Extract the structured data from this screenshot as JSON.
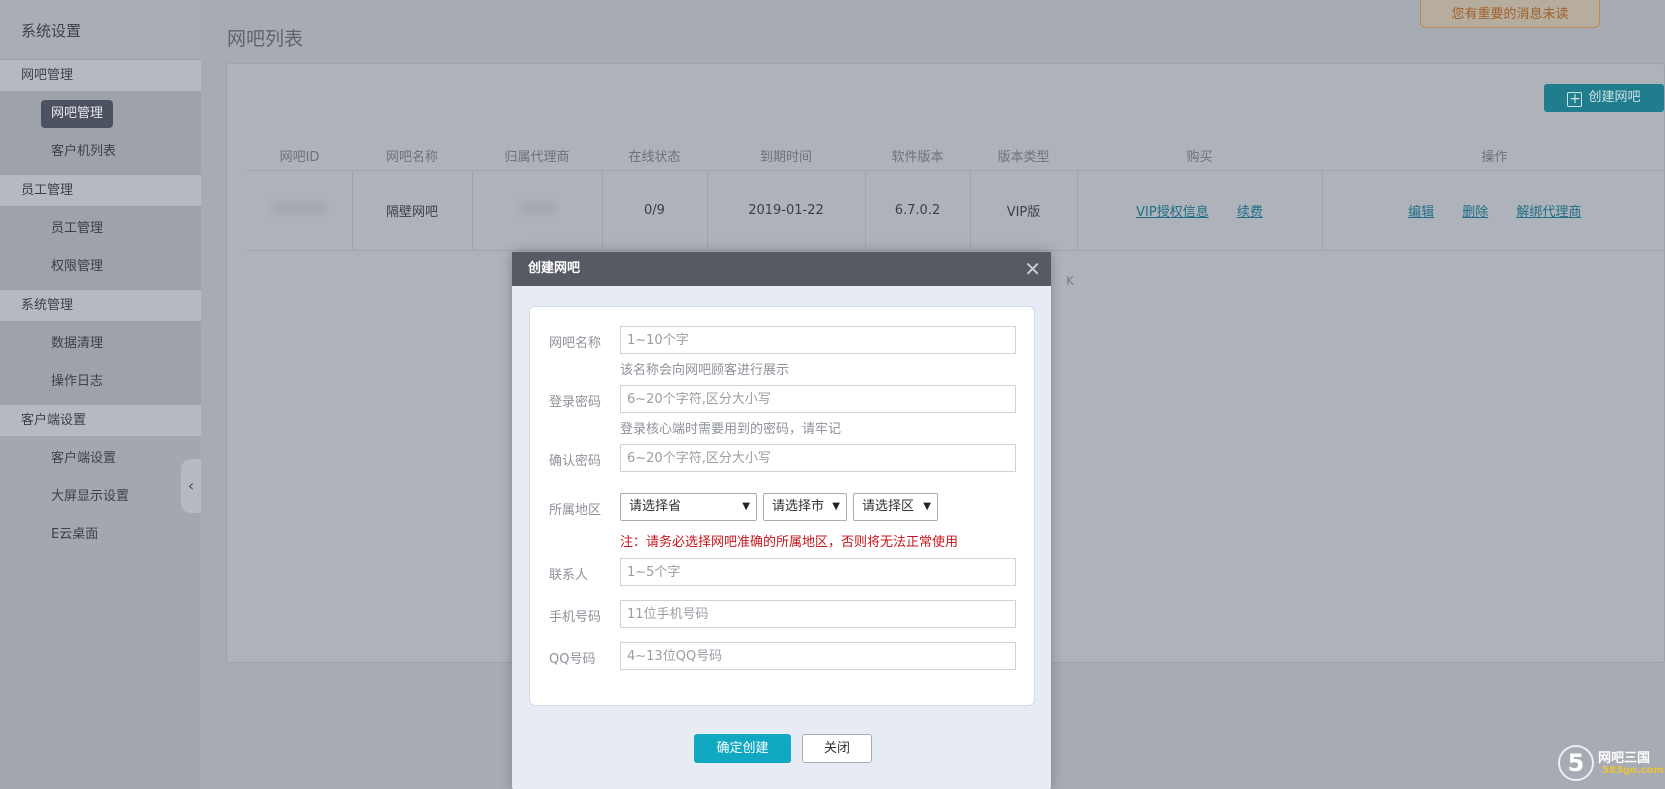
{
  "sidebar": {
    "title": "系统设置",
    "groups": [
      {
        "label": "网吧管理",
        "items": [
          {
            "label": "网吧管理",
            "active": true
          },
          {
            "label": "客户机列表"
          }
        ]
      },
      {
        "label": "员工管理",
        "items": [
          {
            "label": "员工管理"
          },
          {
            "label": "权限管理"
          }
        ]
      },
      {
        "label": "系统管理",
        "items": [
          {
            "label": "数据清理"
          },
          {
            "label": "操作日志"
          }
        ]
      },
      {
        "label": "客户端设置",
        "items": [
          {
            "label": "客户端设置"
          },
          {
            "label": "大屏显示设置"
          },
          {
            "label": "E云桌面"
          }
        ]
      }
    ],
    "collapse_icon": "‹"
  },
  "main": {
    "page_title": "网吧列表",
    "notice": "您有重要的消息未读",
    "create_button": "创建网吧",
    "table": {
      "headers": [
        "网吧ID",
        "网吧名称",
        "归属代理商",
        "在线状态",
        "到期时间",
        "软件版本",
        "版本类型",
        "购买",
        "操作"
      ],
      "row": {
        "name": "隔壁网吧",
        "online": "0/9",
        "expire": "2019-01-22",
        "version": "6.7.0.2",
        "edition": "VIP版",
        "buy_links": [
          "VIP授权信息",
          "续费"
        ],
        "op_links": [
          "编辑",
          "删除",
          "解绑代理商"
        ]
      }
    },
    "pager_fragment": "K"
  },
  "modal": {
    "title": "创建网吧",
    "close": "✕",
    "fields": {
      "name_label": "网吧名称",
      "name_placeholder": "1~10个字",
      "name_hint": "该名称会向网吧顾客进行展示",
      "pwd_label": "登录密码",
      "pwd_placeholder": "6~20个字符,区分大小写",
      "pwd_hint": "登录核心端时需要用到的密码，请牢记",
      "confirm_label": "确认密码",
      "confirm_placeholder": "6~20个字符,区分大小写",
      "region_label": "所属地区",
      "province": "请选择省",
      "city": "请选择市",
      "district": "请选择区",
      "region_warning": "注：请务必选择网吧准确的所属地区，否则将无法正常使用",
      "contact_label": "联系人",
      "contact_placeholder": "1~5个字",
      "phone_label": "手机号码",
      "phone_placeholder": "11位手机号码",
      "qq_label": "QQ号码",
      "qq_placeholder": "4~13位QQ号码"
    },
    "confirm_button": "确定创建",
    "cancel_button": "关闭"
  },
  "watermark": {
    "logo_glyph": "5",
    "title": "网吧三国",
    "site": "583go.com"
  }
}
